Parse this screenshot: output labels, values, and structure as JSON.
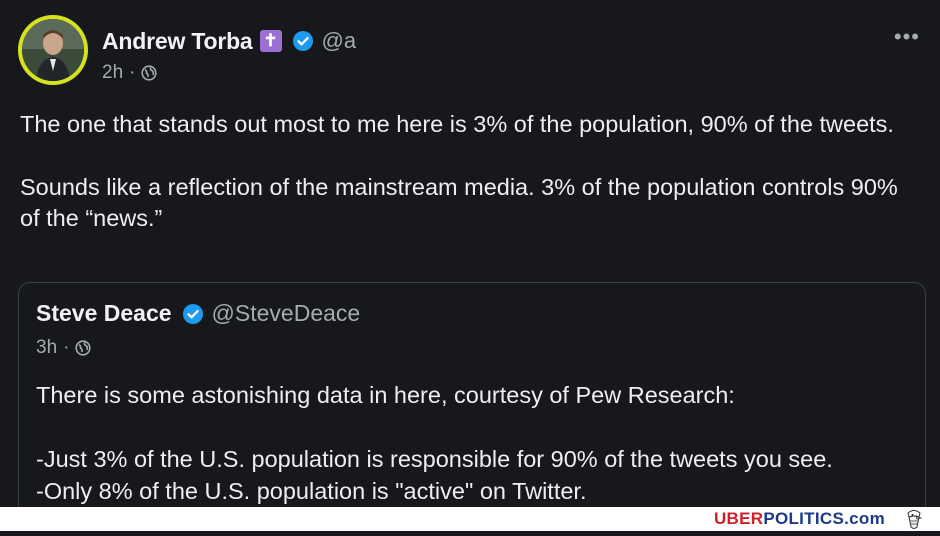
{
  "post": {
    "author_name": "Andrew Torba",
    "cross_badge": "✝",
    "handle": "@a",
    "time": "2h",
    "separator": "·",
    "more_label": "•••",
    "paragraphs": [
      "The one that stands out most to me here is 3% of the population, 90% of the tweets.",
      "Sounds like a reflection of the mainstream media. 3% of the population controls 90% of the “news.”"
    ]
  },
  "quote": {
    "author_name": "Steve Deace",
    "handle": "@SteveDeace",
    "time": "3h",
    "separator": "·",
    "lines": [
      "There is some astonishing data in here, courtesy of Pew Research:",
      "-Just 3% of the U.S. population is responsible for 90% of the tweets you see.",
      "-Only 8% of the U.S. population is \"active\" on Twitter."
    ]
  },
  "watermark": {
    "part1": "UBER",
    "part2": "POLITICS",
    "part3": ".com"
  },
  "colors": {
    "background": "#17181c",
    "avatar_ring": "#d7e21f",
    "verified": "#1d9bf0",
    "badge": "#9b6fd3",
    "watermark_red": "#d0202a",
    "watermark_blue": "#1c3a8c"
  },
  "icons": {
    "verified": "verified-badge-icon",
    "globe": "globe-icon",
    "more": "more-options-icon",
    "watermark_logo": "eagle-icon"
  }
}
